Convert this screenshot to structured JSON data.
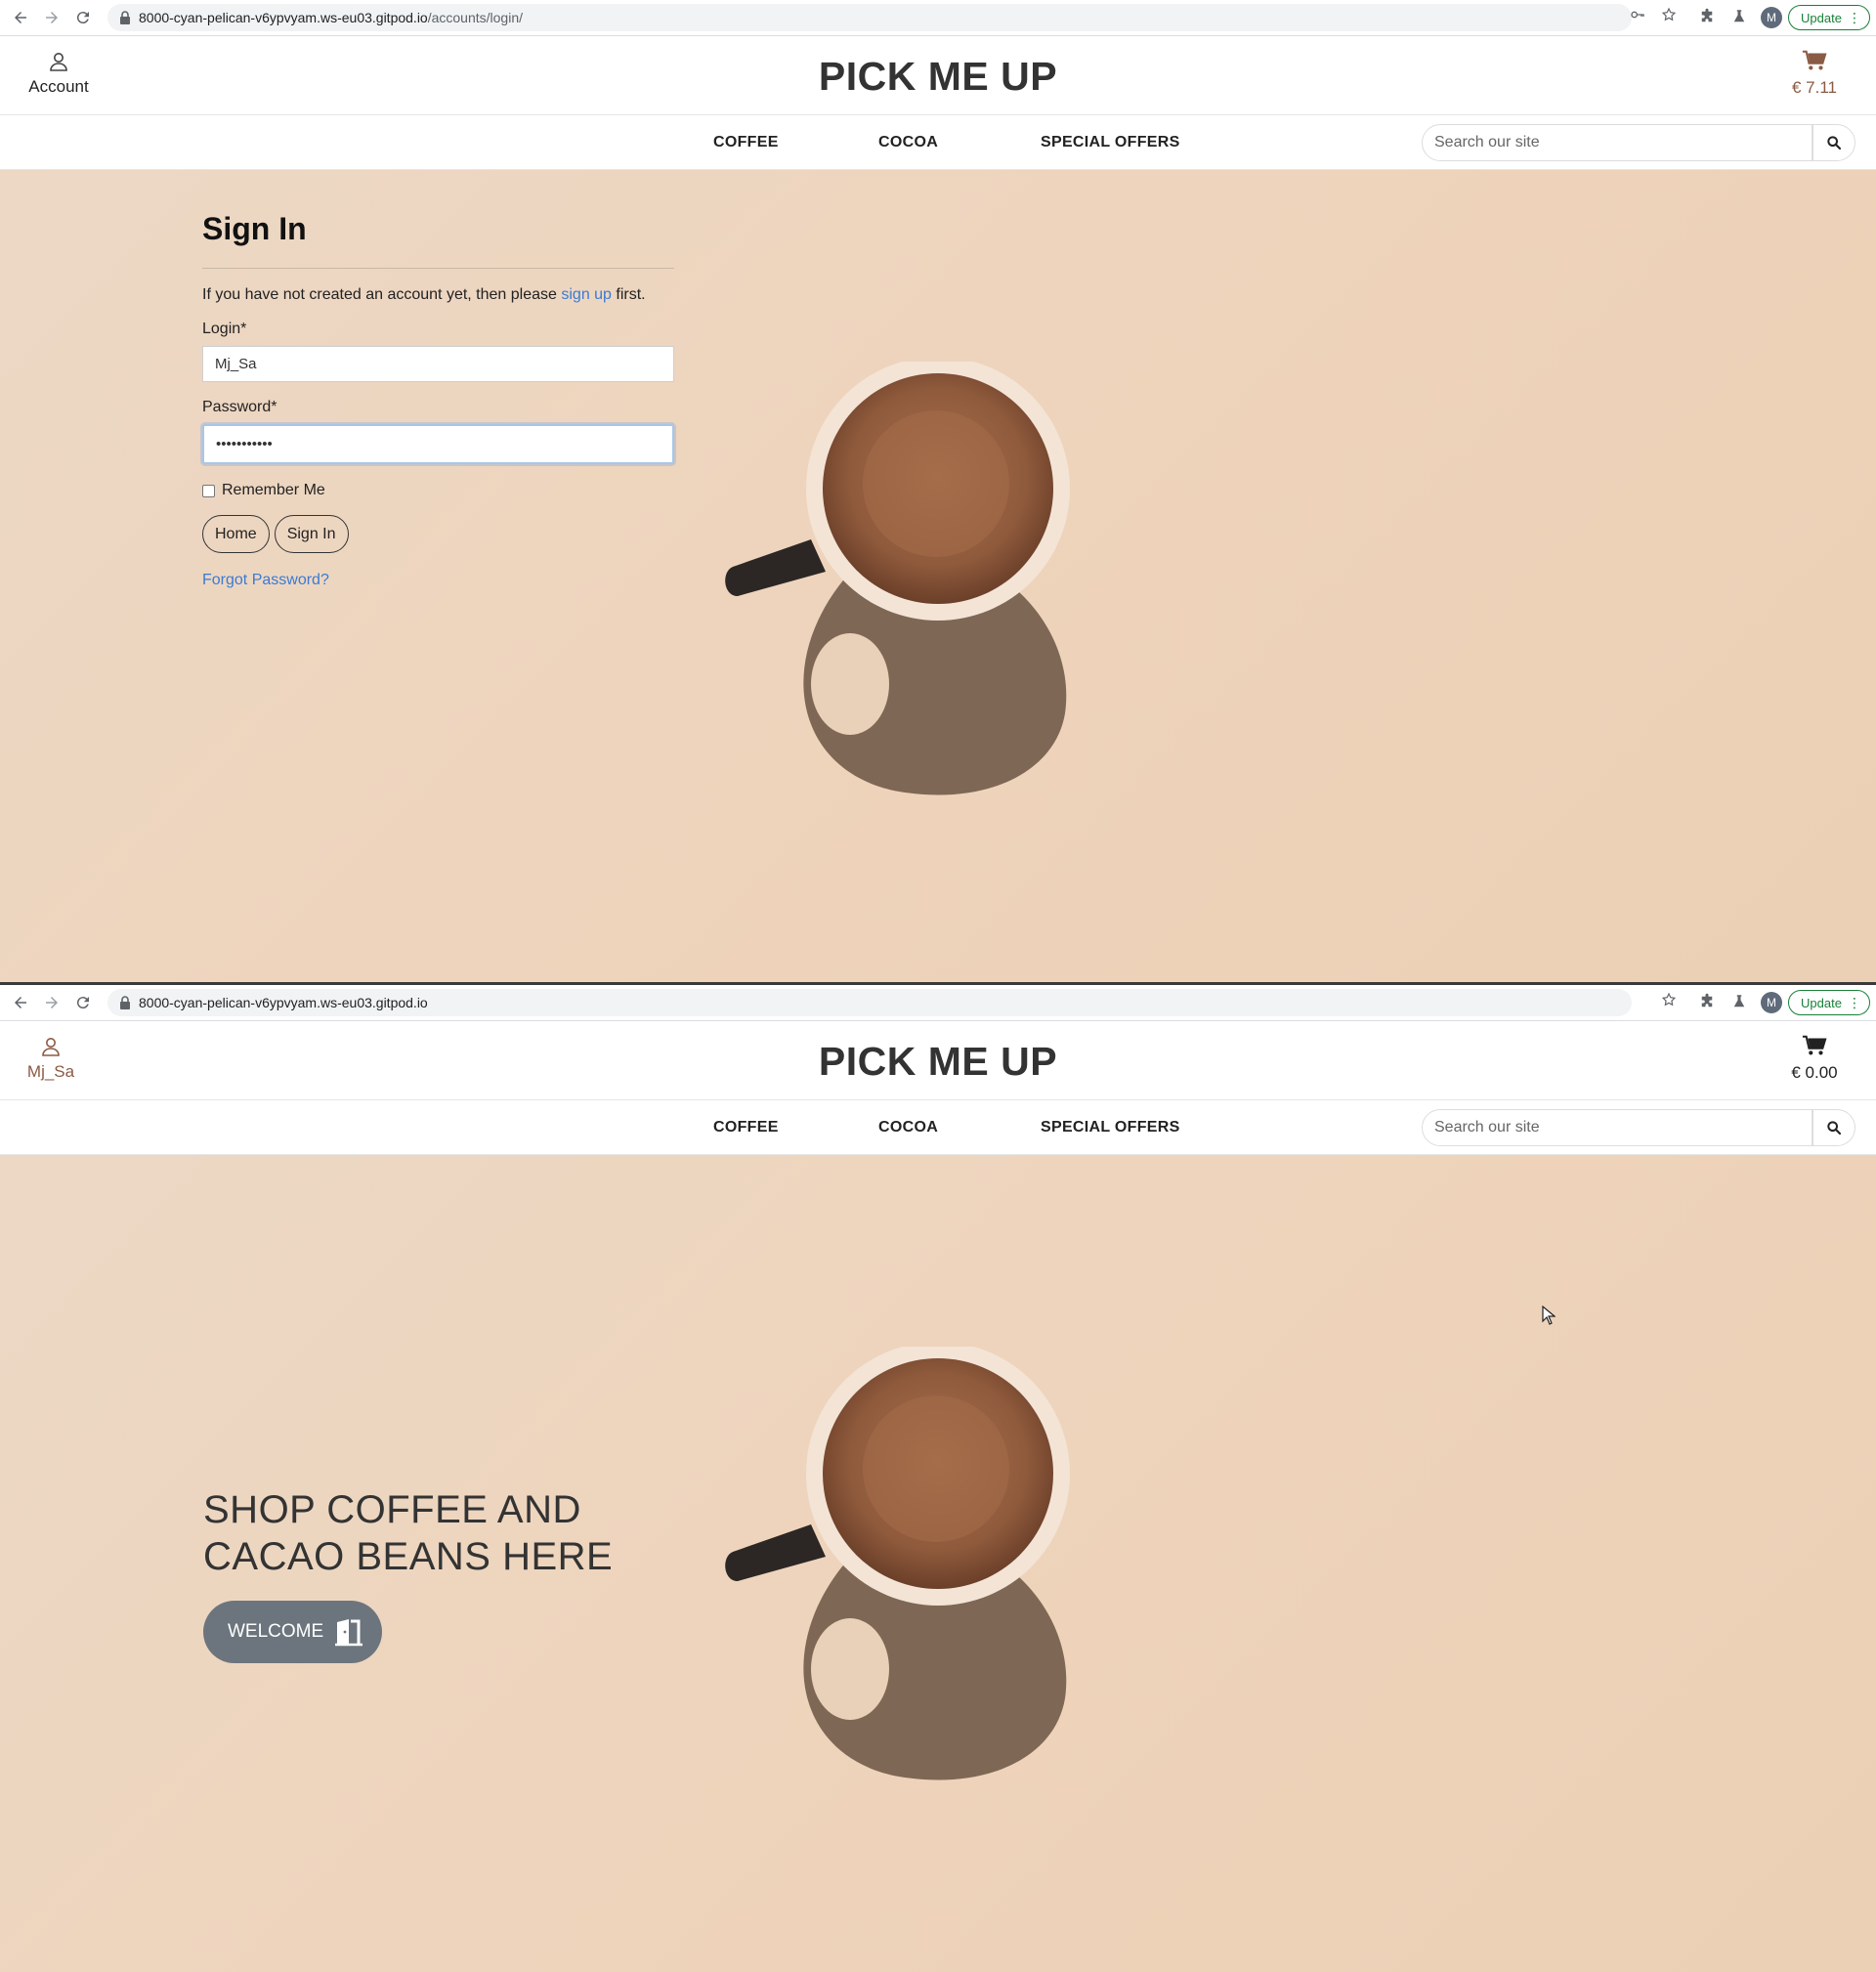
{
  "screens": [
    {
      "browser": {
        "url_host": "8000-cyan-pelican-v6ypvyam.ws-eu03.gitpod.io",
        "url_path": "/accounts/login/",
        "update_label": "Update",
        "profile_initial": "M"
      },
      "header": {
        "account_label": "Account",
        "brand": "PICK ME UP",
        "cart_total": "€ 7.11"
      },
      "nav": {
        "items": [
          "COFFEE",
          "COCOA",
          "SPECIAL OFFERS"
        ],
        "search_placeholder": "Search our site"
      },
      "signin": {
        "title": "Sign In",
        "intro_before": "If you have not created an account yet, then please ",
        "intro_link": "sign up",
        "intro_after": " first.",
        "login_label": "Login*",
        "login_value": "Mj_Sa",
        "password_label": "Password*",
        "password_value": "•••••••••••",
        "remember_label": "Remember Me",
        "home_button": "Home",
        "signin_button": "Sign In",
        "forgot_link": "Forgot Password?"
      }
    },
    {
      "browser": {
        "url_host": "8000-cyan-pelican-v6ypvyam.ws-eu03.gitpod.io",
        "url_path": "",
        "update_label": "Update",
        "profile_initial": "M"
      },
      "header": {
        "account_label": "Mj_Sa",
        "brand": "PICK ME UP",
        "cart_total": "€ 0.00"
      },
      "nav": {
        "items": [
          "COFFEE",
          "COCOA",
          "SPECIAL OFFERS"
        ],
        "search_placeholder": "Search our site"
      },
      "hero": {
        "line1": "SHOP COFFEE AND",
        "line2": "CACAO BEANS HERE",
        "cta": "WELCOME"
      }
    }
  ],
  "colors": {
    "accent_link": "#3a7bd5",
    "cart_brown": "#8a5a44",
    "hero_bg": "#edd5bf",
    "welcome_button": "#6c757d"
  },
  "icons": [
    "back-icon",
    "forward-icon",
    "reload-icon",
    "lock-icon",
    "key-icon",
    "star-icon",
    "puzzle-icon",
    "flask-icon",
    "user-icon",
    "cart-icon",
    "search-icon",
    "door-icon"
  ]
}
